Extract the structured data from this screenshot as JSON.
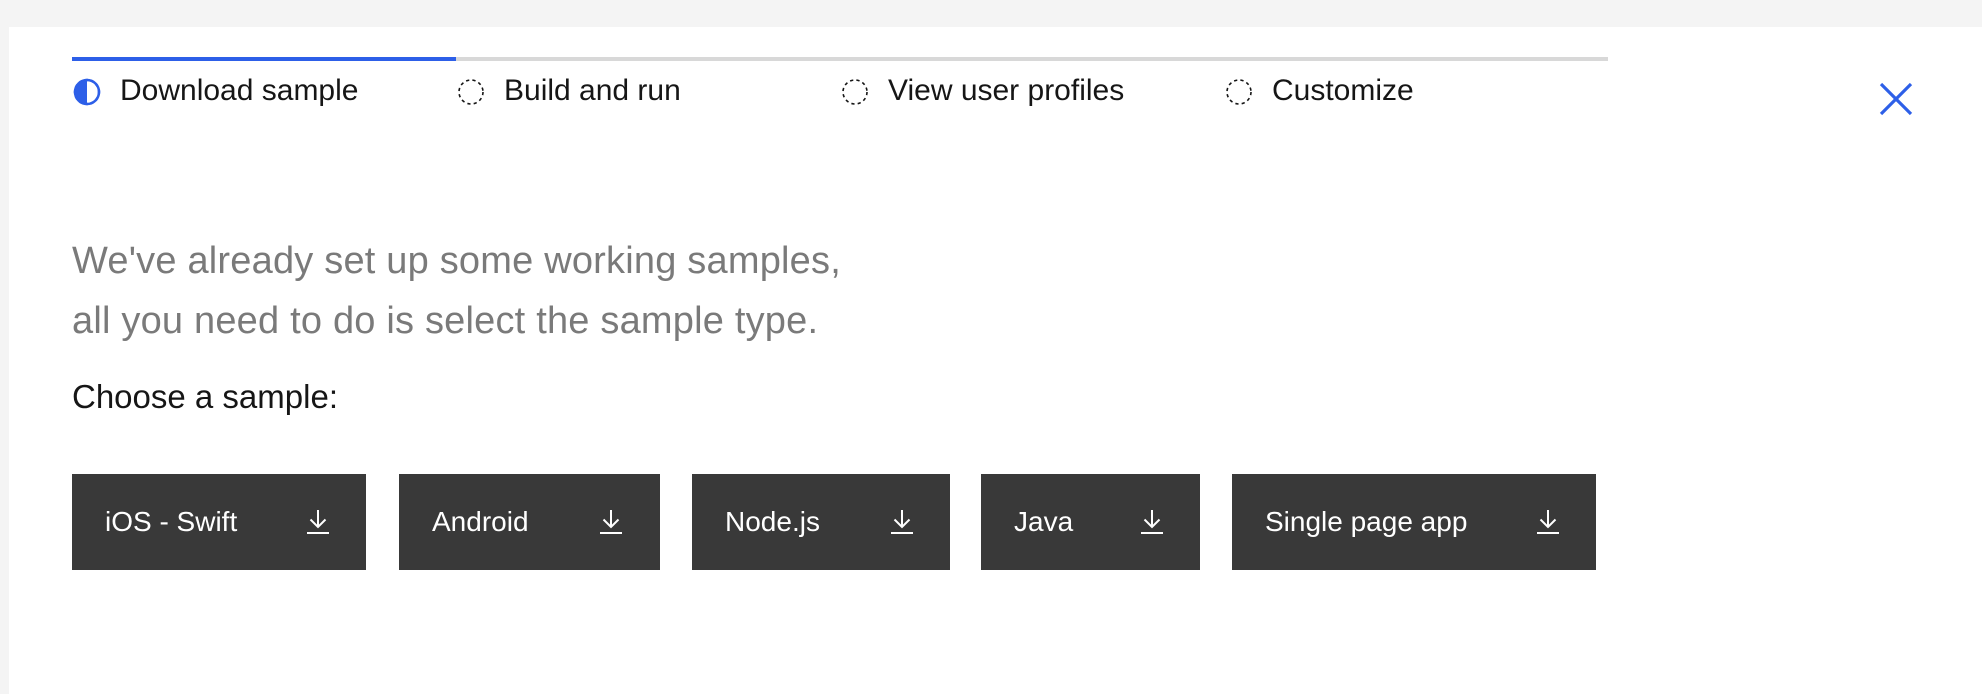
{
  "steps": [
    {
      "label": "Download sample",
      "state": "current"
    },
    {
      "label": "Build and run",
      "state": "incomplete"
    },
    {
      "label": "View user profiles",
      "state": "incomplete"
    },
    {
      "label": "Customize",
      "state": "incomplete"
    }
  ],
  "close": {
    "icon": "close-icon"
  },
  "intro": {
    "line1": "We've already set up some working samples,",
    "line2": "all you need to do is select the sample type."
  },
  "choose_label": "Choose a sample:",
  "samples": [
    {
      "label": "iOS - Swift",
      "icon": "download-icon"
    },
    {
      "label": "Android",
      "icon": "download-icon"
    },
    {
      "label": "Node.js",
      "icon": "download-icon"
    },
    {
      "label": "Java",
      "icon": "download-icon"
    },
    {
      "label": "Single page app",
      "icon": "download-icon"
    }
  ],
  "colors": {
    "accent": "#2d5fe8",
    "button_bg": "#393939",
    "button_text": "#ffffff",
    "intro_text": "#7a7a7a",
    "track": "#d8d8d8",
    "page_bg": "#f4f4f4",
    "panel_bg": "#ffffff"
  }
}
